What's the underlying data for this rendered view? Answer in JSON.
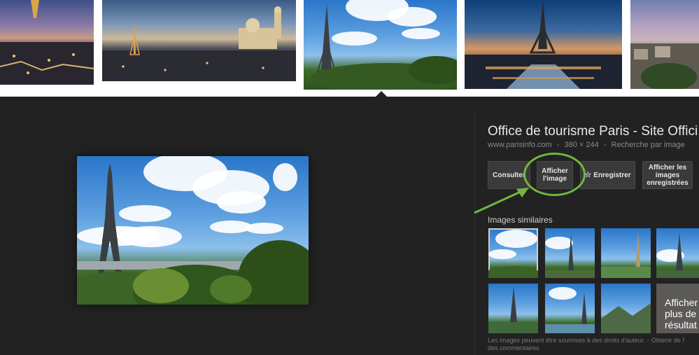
{
  "detail": {
    "title": "Office de tourisme Paris - Site Offici",
    "domain": "www.parisinfo.com",
    "separator": "-",
    "dimensions": "380 × 244",
    "search_by_image": "Recherche par image"
  },
  "buttons": {
    "visit": "Consulter",
    "view_image": "Afficher l'image",
    "save": "Enregistrer",
    "view_saved": "Afficher les images enregistrées"
  },
  "similar": {
    "label": "Images similaires",
    "more": "Afficher plus de résultat"
  },
  "footer": {
    "copyright_note": "Les images peuvent être soumises à des droits d'auteur.",
    "separator": "-",
    "feedback": "Obtenir de l'",
    "comments": "des commentaires"
  },
  "icons": [
    "star-icon",
    "eiffel-tower-thumbnail"
  ],
  "colors": {
    "panel_bg": "#222222",
    "annotation_green": "#72b640",
    "button_bg": "#3a3a3a"
  }
}
